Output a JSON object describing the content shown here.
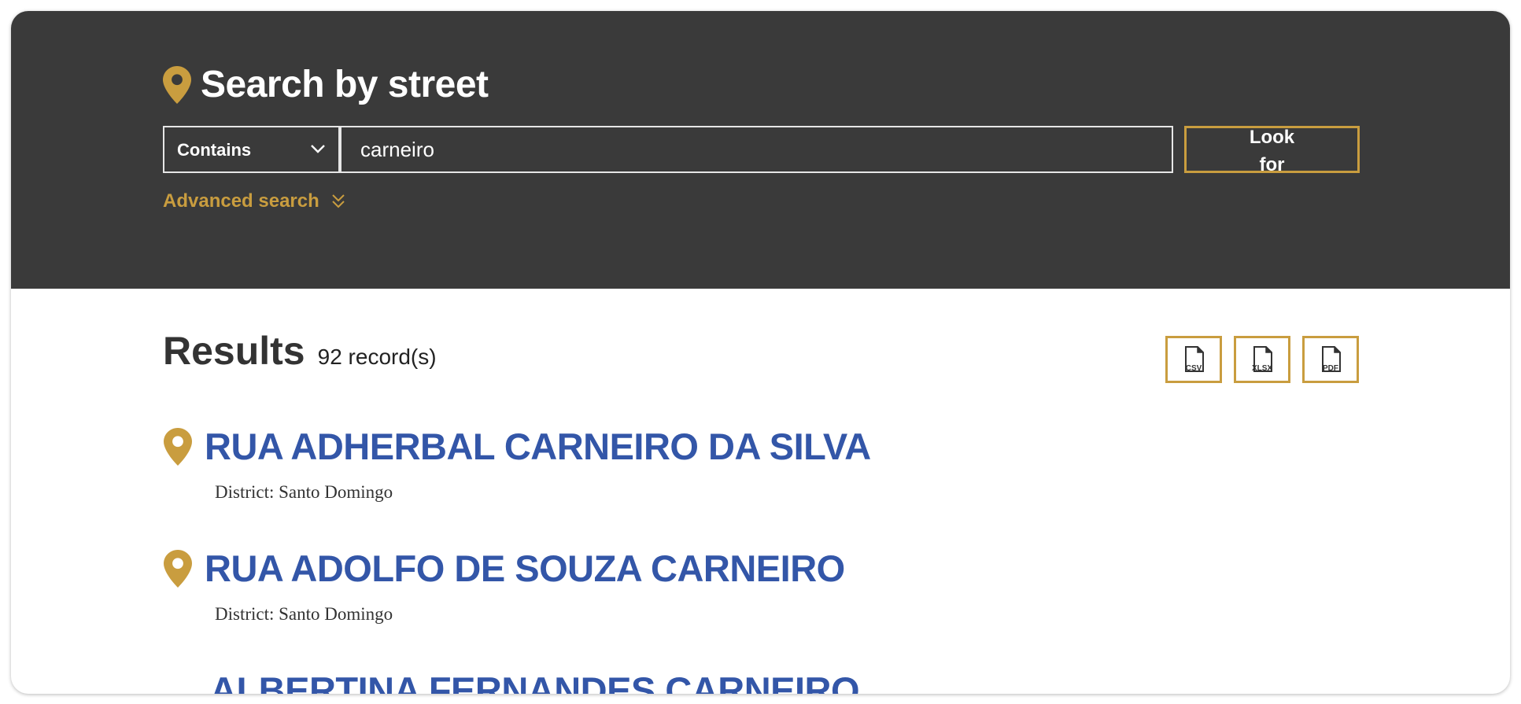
{
  "search": {
    "title": "Search by street",
    "mode_value": "Contains",
    "query_value": "carneiro",
    "button_label": "Look for",
    "advanced_label": "Advanced search"
  },
  "results": {
    "heading": "Results",
    "count_text": "92 record(s)",
    "exports": [
      {
        "label": "CSV",
        "icon": "csv-file-icon"
      },
      {
        "label": "XLSX",
        "icon": "xlsx-file-icon"
      },
      {
        "label": "PDF",
        "icon": "pdf-file-icon"
      }
    ],
    "items": [
      {
        "name": "RUA ADHERBAL CARNEIRO DA SILVA",
        "district": "District: Santo Domingo"
      },
      {
        "name": "RUA ADOLFO DE SOUZA CARNEIRO",
        "district": "District: Santo Domingo"
      },
      {
        "name": "ALBERTINA FERNANDES CARNEIRO",
        "district": ""
      }
    ]
  },
  "colors": {
    "panel_bg": "#3a3a3a",
    "accent_gold": "#c99d3f",
    "link_blue": "#3356a8"
  }
}
